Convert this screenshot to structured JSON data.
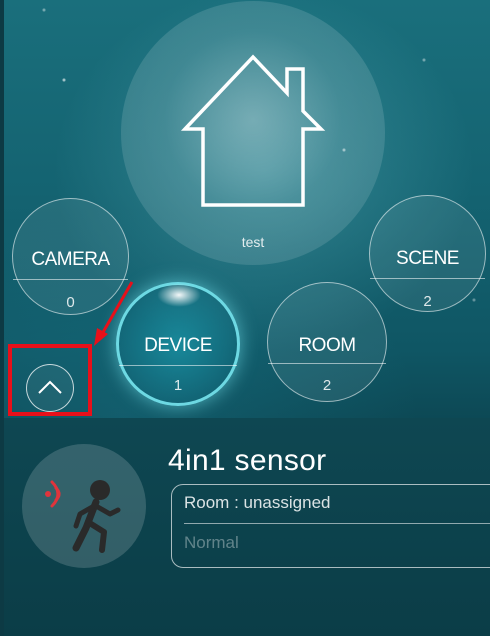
{
  "home": {
    "name": "test"
  },
  "camera": {
    "label": "CAMERA",
    "count": "0"
  },
  "scene": {
    "label": "SCENE",
    "count": "2"
  },
  "device": {
    "label": "DEVICE",
    "count": "1"
  },
  "room": {
    "label": "ROOM",
    "count": "2"
  },
  "sensor": {
    "title": "4in1 sensor",
    "room": "Room : unassigned",
    "status": "Normal"
  },
  "icons": {
    "house": "house-icon",
    "up": "chevron-up-icon",
    "sensor": "motion-sensor-icon"
  },
  "colors": {
    "accent": "#78e6f0",
    "highlight": "#e8101a",
    "motion_waves": "#e0343c"
  }
}
